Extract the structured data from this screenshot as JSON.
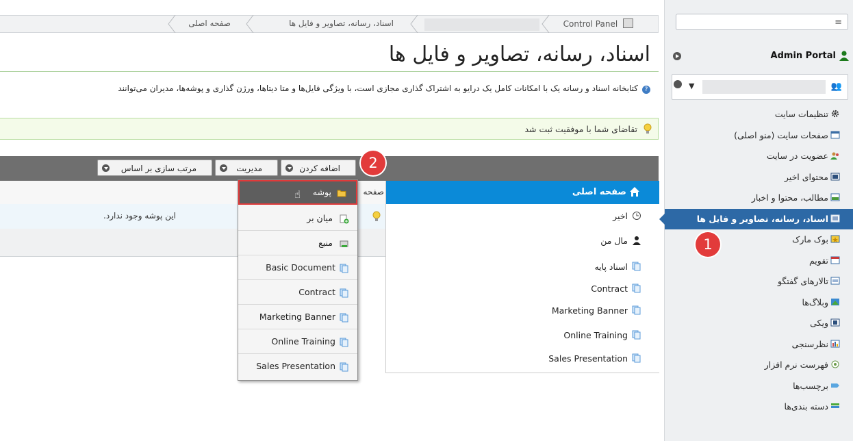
{
  "sidebar": {
    "search_placeholder": "",
    "portal_label": "Admin Portal",
    "items": [
      {
        "label": "تنظیمات سایت",
        "icon": "gear-icon"
      },
      {
        "label": "صفحات سایت (منو اصلی)",
        "icon": "page-icon"
      },
      {
        "label": "عضویت در سایت",
        "icon": "users-icon"
      },
      {
        "label": "محتوای اخیر",
        "icon": "recent-icon"
      },
      {
        "label": "مطالب، محتوا و اخبار",
        "icon": "news-icon"
      },
      {
        "label": "اسناد، رسانه، تصاویر و فایل ها",
        "icon": "documents-icon",
        "active": true
      },
      {
        "label": "بوک مارک",
        "icon": "bookmark-icon"
      },
      {
        "label": "تقویم",
        "icon": "calendar-icon"
      },
      {
        "label": "تالارهای گفتگو",
        "icon": "forum-icon"
      },
      {
        "label": "وبلاگ‌ها",
        "icon": "blog-icon"
      },
      {
        "label": "ویکی",
        "icon": "wiki-icon"
      },
      {
        "label": "نظرسنجی",
        "icon": "poll-icon"
      },
      {
        "label": "فهرست نرم افزار",
        "icon": "software-icon"
      },
      {
        "label": "برچسب‌ها",
        "icon": "tag-icon"
      },
      {
        "label": "دسته بندی‌ها",
        "icon": "category-icon"
      }
    ]
  },
  "breadcrumb": {
    "control_panel": "Control Panel",
    "section": "اسناد، رسانه، تصاویر و فایل ها",
    "home": "صفحه اصلی"
  },
  "page": {
    "title": "اسناد، رسانه، تصاویر و فایل ها",
    "description": "کتابخانه اسناد و رسانه یک با امکانات کامل یک درایو به اشتراک گذاری مجازی است، با ویژگی فایل‌ها و متا دیتاها، ورژن گذاری و پوشه‌ها، مدیران می‌توانند",
    "success_message": "تقاضای شما با موفقیت ثبت شد"
  },
  "toolbar": {
    "add_label": "اضافه کردن",
    "manage_label": "مدیریت",
    "sort_label": "مرتب سازی بر اساس"
  },
  "tree": {
    "header": "صفحه اصلی",
    "items": [
      {
        "label": "اخیر",
        "icon": "clock-icon"
      },
      {
        "label": "مال من",
        "icon": "user-icon"
      },
      {
        "label": "اسناد پایه",
        "icon": "document-icon"
      },
      {
        "label": "Contract",
        "icon": "document-icon"
      },
      {
        "label": "Marketing Banner",
        "icon": "document-icon"
      },
      {
        "label": "Online Training",
        "icon": "document-icon"
      },
      {
        "label": "Sales Presentation",
        "icon": "document-icon"
      }
    ]
  },
  "list": {
    "header": "صفحه",
    "empty_message": "این پوشه وجود ندارد."
  },
  "dropdown": {
    "items": [
      {
        "label": "پوشه",
        "icon": "folder-icon"
      },
      {
        "label": "میان بر",
        "icon": "shortcut-icon"
      },
      {
        "label": "منبع",
        "icon": "repository-icon"
      },
      {
        "label": "Basic Document",
        "icon": "document-icon"
      },
      {
        "label": "Contract",
        "icon": "document-icon"
      },
      {
        "label": "Marketing Banner",
        "icon": "document-icon"
      },
      {
        "label": "Online Training",
        "icon": "document-icon"
      },
      {
        "label": "Sales Presentation",
        "icon": "document-icon"
      }
    ]
  },
  "annotations": {
    "step1": "1",
    "step2": "2"
  },
  "colors": {
    "accent": "#0b8ad8",
    "sidebar_active": "#2d69a6",
    "badge": "#e23b3b",
    "toolbar": "#6f6f6f"
  }
}
